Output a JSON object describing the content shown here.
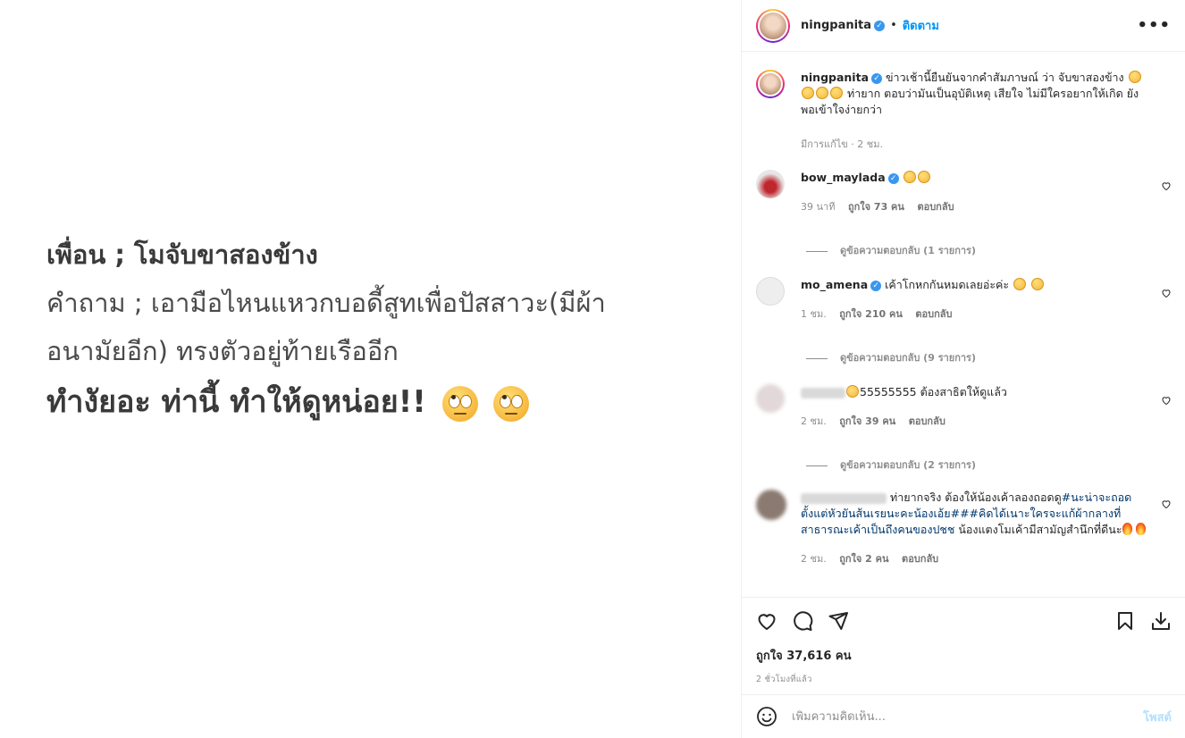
{
  "image": {
    "line1": "เพื่อน ; โมจับขาสองข้าง",
    "line2": "คำถาม ; เอามือไหนแหวกบอดี้สูทเพื่อปัสสาวะ(มีผ้า",
    "line3": "อนามัยอีก) ทรงตัวอยู่ท้ายเรืออีก",
    "line4": "ทำงัยอะ ท่านี้ ทำให้ดูหน่อย!!",
    "emoji": "face-with-rolling-eyes"
  },
  "header": {
    "username": "ningpanita",
    "dot": "•",
    "follow": "ติดตาม",
    "more": "•••"
  },
  "caption": {
    "username": "ningpanita",
    "text_a": "ข่าวเช้านี้ยืนยันจากคำสัมภาษณ์ ว่า จับขาสองข้าง",
    "text_b": "ท่ายาก ตอบว่ามันเป็นอุบัติเหตุ เสียใจ ไม่มีใครอยากให้เกิด ยังพอเข้าใจง่ายกว่า",
    "meta": "มีการแก้ไข · 2 ชม."
  },
  "comments": [
    {
      "username": "bow_maylada",
      "text": "",
      "time": "39 นาที",
      "likes": "ถูกใจ 73 คน",
      "reply": "ตอบกลับ",
      "replies": "ดูข้อความตอบกลับ (1 รายการ)"
    },
    {
      "username": "mo_amena",
      "text": "เค้าโกหกกันหมดเลยอ่ะค่ะ",
      "time": "1 ชม.",
      "likes": "ถูกใจ 210 คน",
      "reply": "ตอบกลับ",
      "replies": "ดูข้อความตอบกลับ (9 รายการ)"
    },
    {
      "username": "",
      "text": "55555555 ต้องสาธิตให้ดูแล้ว",
      "time": "2 ชม.",
      "likes": "ถูกใจ 39 คน",
      "reply": "ตอบกลับ",
      "replies": "ดูข้อความตอบกลับ (2 รายการ)"
    },
    {
      "username": "",
      "text_a": "ท่ายากจริง ต้องให้น้องเค้าลองถอดดู",
      "link": "#นะน่าจะถอดตั้งแต่หัวยันส้นเรยนะคะน้องเอ้ย###คิดได้เนาะใครจะแก้ผ้ากลางที่สาธารณะเค้าเป็นถึงคนของปชช",
      "text_b": " น้องแตงโมเค้ามีสามัญสำนึกที่ดีนะ",
      "time": "2 ชม.",
      "likes": "ถูกใจ 2 คน",
      "reply": "ตอบกลับ"
    }
  ],
  "actions": {
    "likes": "ถูกใจ 37,616 คน",
    "time": "2 ชั่วโมงที่แล้ว"
  },
  "add_comment": {
    "placeholder": "เพิ่มความคิดเห็น...",
    "post": "โพสต์"
  },
  "colors": {
    "link": "#0095f6",
    "verified": "#3897f0",
    "post_disabled": "#b2dffc"
  }
}
